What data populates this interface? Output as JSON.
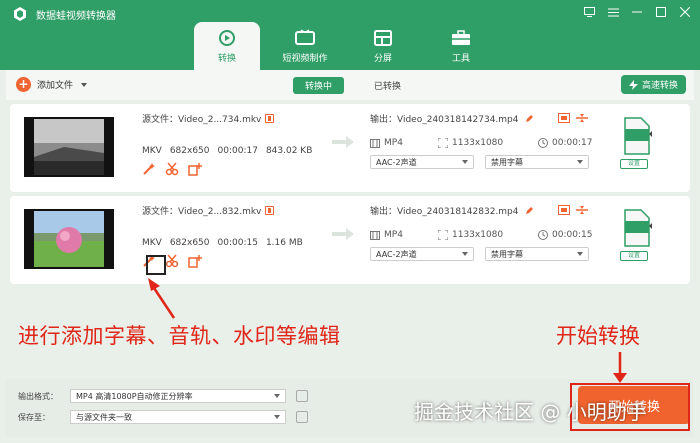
{
  "window": {
    "title": "数据蛙视频转换器",
    "controls": [
      "feedback-icon",
      "menu-icon",
      "minimize-icon",
      "maximize-icon",
      "close-icon"
    ]
  },
  "nav": [
    {
      "label": "转换",
      "icon": "refresh-icon",
      "active": true
    },
    {
      "label": "短视频制作",
      "icon": "tv-icon",
      "active": false
    },
    {
      "label": "分屏",
      "icon": "split-screen-icon",
      "active": false
    },
    {
      "label": "工具",
      "icon": "toolbox-icon",
      "active": false
    }
  ],
  "toolbar": {
    "add_file": "添加文件",
    "tab_converting": "转换中",
    "tab_converted": "已转换",
    "fast_convert": "高速转换"
  },
  "rows": [
    {
      "source_name": "源文件：Video_2...734.mkv",
      "format": "MKV",
      "resolution": "682x650",
      "duration": "00:00:17",
      "size": "843.02 KB",
      "output_name": "输出：Video_240318142734.mp4",
      "out_format": "MP4",
      "out_resolution": "1133x1080",
      "out_duration": "00:00:17",
      "audio": "AAC-2声道",
      "subtitle": "禁用字幕",
      "settings": "设置"
    },
    {
      "source_name": "源文件：Video_2...832.mkv",
      "format": "MKV",
      "resolution": "682x650",
      "duration": "00:00:15",
      "size": "1.16 MB",
      "output_name": "输出：Video_240318142832.mp4",
      "out_format": "MP4",
      "out_resolution": "1133x1080",
      "out_duration": "00:00:15",
      "audio": "AAC-2声道",
      "subtitle": "禁用字幕",
      "settings": "设置"
    }
  ],
  "bottom": {
    "output_format_label": "输出格式：",
    "output_format_value": "MP4 高清1080P自动修正分辨率",
    "save_to_label": "保存至：",
    "save_to_value": "与源文件夹一致",
    "start_label": "开始转换"
  },
  "annotations": {
    "left": "进行添加字幕、音轨、水印等编辑",
    "right": "开始转换"
  },
  "watermark": "掘金技术社区 @ 小明助手",
  "colors": {
    "brand": "#2f9e67",
    "accent": "#f0632e",
    "annotation": "#e02618"
  }
}
